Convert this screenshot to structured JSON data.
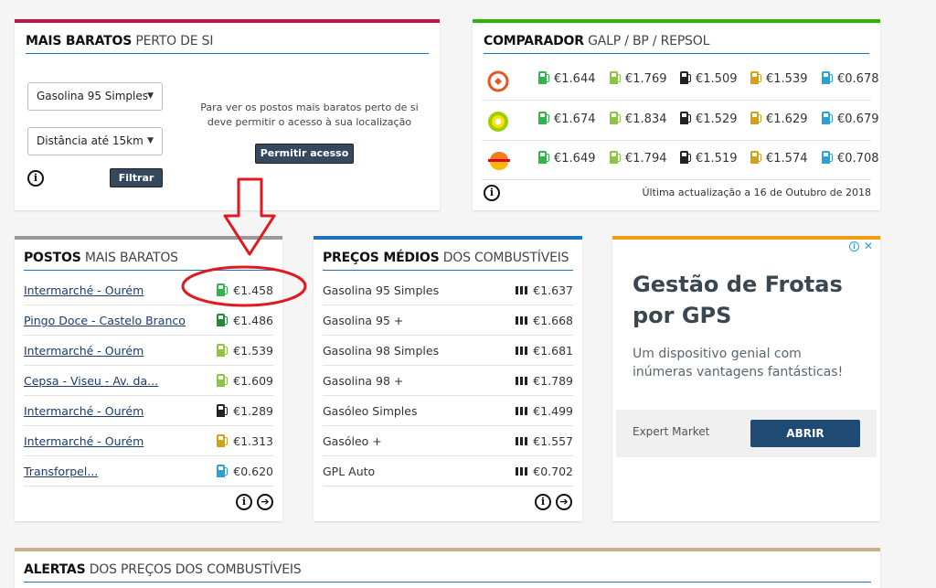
{
  "mais_baratos": {
    "title_bold": "MAIS BARATOS",
    "title_rest": " PERTO DE SI",
    "fuel_select": "Gasolina 95 Simples",
    "distance_select": "Distância até 15km",
    "filter_button": "Filtrar",
    "location_message_line1": "Para ver os postos mais baratos perto de si",
    "location_message_line2": "deve permitir o acesso à sua localização",
    "allow_button": "Permitir acesso",
    "accent_color": "#c0174b"
  },
  "comparador": {
    "title_bold": "COMPARADOR",
    "title_rest": " GALP / BP / REPSOL",
    "accent_color": "#2db500",
    "fuel_colors": [
      "#2fb54a",
      "#8cc63f",
      "#222222",
      "#d4a017",
      "#29a3d6"
    ],
    "rows": [
      {
        "brand": "galp",
        "icon": "galp-logo-icon",
        "prices": [
          "€1.644",
          "€1.769",
          "€1.509",
          "€1.539",
          "€0.678"
        ]
      },
      {
        "brand": "bp",
        "icon": "bp-logo-icon",
        "prices": [
          "€1.674",
          "€1.834",
          "€1.529",
          "€1.629",
          "€0.679"
        ]
      },
      {
        "brand": "repsol",
        "icon": "repsol-logo-icon",
        "prices": [
          "€1.649",
          "€1.794",
          "€1.519",
          "€1.574",
          "€0.708"
        ]
      }
    ],
    "last_update": "Última actualização a 16 de Outubro de 2018"
  },
  "postos": {
    "title_bold": "POSTOS",
    "title_rest": " MAIS BARATOS",
    "accent_color": "#999999",
    "items": [
      {
        "name": "Intermarché - Ourém",
        "price": "€1.458",
        "fuel_color": "#2fb54a"
      },
      {
        "name": "Pingo Doce - Castelo Branco",
        "price": "€1.486",
        "fuel_color": "#1f8a3a"
      },
      {
        "name": "Intermarché - Ourém",
        "price": "€1.539",
        "fuel_color": "#8cc63f"
      },
      {
        "name": "Cepsa - Viseu - Av. da...",
        "price": "€1.609",
        "fuel_color": "#8cc63f"
      },
      {
        "name": "Intermarché - Ourém",
        "price": "€1.289",
        "fuel_color": "#222222"
      },
      {
        "name": "Intermarché - Ourém",
        "price": "€1.313",
        "fuel_color": "#d4a017"
      },
      {
        "name": "Transforpel...",
        "price": "€0.620",
        "fuel_color": "#29a3d6"
      }
    ]
  },
  "precos_medios": {
    "title_bold": "PREÇOS MÉDIOS",
    "title_rest": " DOS COMBUSTÍVEIS",
    "accent_color": "#1e73be",
    "items": [
      {
        "name": "Gasolina 95 Simples",
        "price": "€1.637"
      },
      {
        "name": "Gasolina 95 +",
        "price": "€1.668"
      },
      {
        "name": "Gasolina 98 Simples",
        "price": "€1.681"
      },
      {
        "name": "Gasolina 98 +",
        "price": "€1.789"
      },
      {
        "name": "Gasóleo Simples",
        "price": "€1.499"
      },
      {
        "name": "Gasóleo +",
        "price": "€1.557"
      },
      {
        "name": "GPL Auto",
        "price": "€0.702"
      }
    ]
  },
  "ad": {
    "headline": "Gestão de Frotas por GPS",
    "body": "Um dispositivo genial com inúmeras vantagens fantásticas!",
    "advertiser": "Expert Market",
    "cta": "ABRIR",
    "accent_color": "#f39c12",
    "close_glyph": "✕"
  },
  "alertas": {
    "title_bold": "ALERTAS",
    "title_rest": " DOS PREÇOS DOS COMBUSTÍVEIS",
    "accent_color": "#c8b08a"
  },
  "annotation": {
    "color": "#e0191f"
  }
}
